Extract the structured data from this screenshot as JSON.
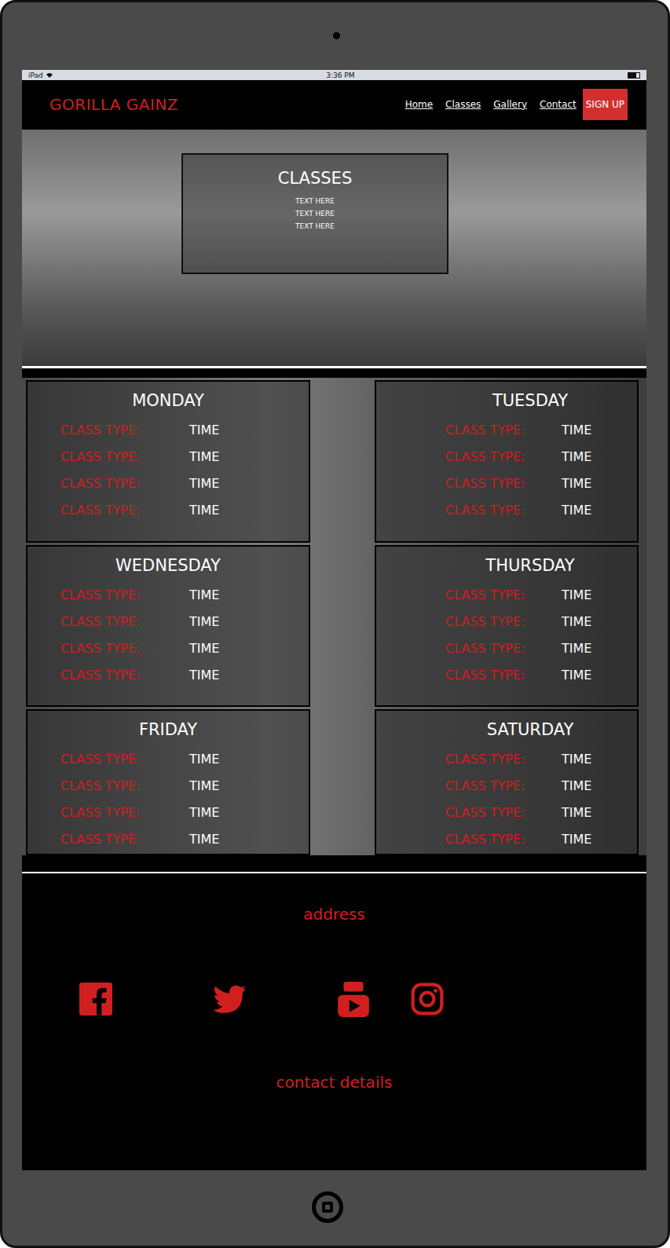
{
  "status_bar": {
    "device": "iPad",
    "time": "3:36 PM"
  },
  "nav": {
    "brand": "GORILLA GAINZ",
    "links": [
      "Home",
      "Classes",
      "Gallery",
      "Contact"
    ],
    "cta": "SIGN UP"
  },
  "hero": {
    "title": "CLASSES",
    "lines": [
      "TEXT HERE",
      "TEXT HERE",
      "TEXT HERE"
    ]
  },
  "schedule": [
    {
      "day": "MONDAY",
      "classes": [
        {
          "type": "CLASS TYPE:",
          "time": "TIME"
        },
        {
          "type": "CLASS TYPE:",
          "time": "TIME"
        },
        {
          "type": "CLASS TYPE:",
          "time": "TIME"
        },
        {
          "type": "CLASS TYPE:",
          "time": "TIME"
        }
      ]
    },
    {
      "day": "TUESDAY",
      "classes": [
        {
          "type": "CLASS TYPE:",
          "time": "TIME"
        },
        {
          "type": "CLASS TYPE:",
          "time": "TIME"
        },
        {
          "type": "CLASS TYPE:",
          "time": "TIME"
        },
        {
          "type": "CLASS TYPE:",
          "time": "TIME"
        }
      ]
    },
    {
      "day": "WEDNESDAY",
      "classes": [
        {
          "type": "CLASS TYPE:",
          "time": "TIME"
        },
        {
          "type": "CLASS TYPE:",
          "time": "TIME"
        },
        {
          "type": "CLASS TYPE:",
          "time": "TIME"
        },
        {
          "type": "CLASS TYPE:",
          "time": "TIME"
        }
      ]
    },
    {
      "day": "THURSDAY",
      "classes": [
        {
          "type": "CLASS TYPE:",
          "time": "TIME"
        },
        {
          "type": "CLASS TYPE:",
          "time": "TIME"
        },
        {
          "type": "CLASS TYPE:",
          "time": "TIME"
        },
        {
          "type": "CLASS TYPE:",
          "time": "TIME"
        }
      ]
    },
    {
      "day": "FRIDAY",
      "classes": [
        {
          "type": "CLASS TYPE:",
          "time": "TIME"
        },
        {
          "type": "CLASS TYPE:",
          "time": "TIME"
        },
        {
          "type": "CLASS TYPE:",
          "time": "TIME"
        },
        {
          "type": "CLASS TYPE:",
          "time": "TIME"
        }
      ]
    },
    {
      "day": "SATURDAY",
      "classes": [
        {
          "type": "CLASS TYPE:",
          "time": "TIME"
        },
        {
          "type": "CLASS TYPE:",
          "time": "TIME"
        },
        {
          "type": "CLASS TYPE:",
          "time": "TIME"
        },
        {
          "type": "CLASS TYPE:",
          "time": "TIME"
        }
      ]
    }
  ],
  "footer": {
    "address": "address",
    "contact": "contact details"
  }
}
